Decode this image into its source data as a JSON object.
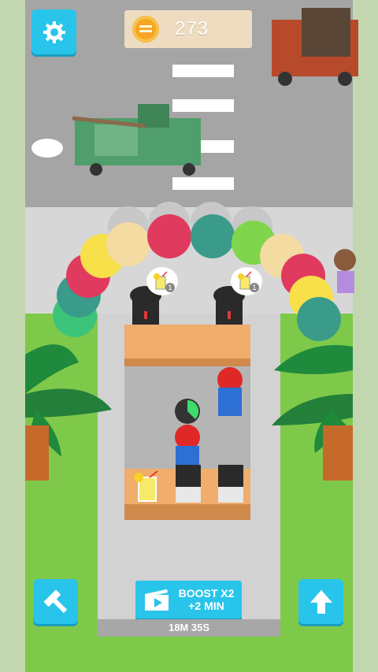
{
  "hud": {
    "settings_icon": "gear-icon",
    "coin_icon": "coin-icon",
    "coins": "273",
    "build_icon": "hammer-icon",
    "upgrade_icon": "arrow-up-icon"
  },
  "boost": {
    "icon": "video-clapper-icon",
    "line1": "BOOST X2",
    "line2": "+2 MIN"
  },
  "timer": "18M 35S",
  "orders": [
    {
      "item": "lemonade-icon",
      "count": "1"
    },
    {
      "item": "lemonade-icon",
      "count": "1"
    }
  ],
  "colors": {
    "button": "#29c4ea",
    "road": "#a4a4a4",
    "grass": "#7fc94a",
    "counter": "#f0ad6b"
  }
}
